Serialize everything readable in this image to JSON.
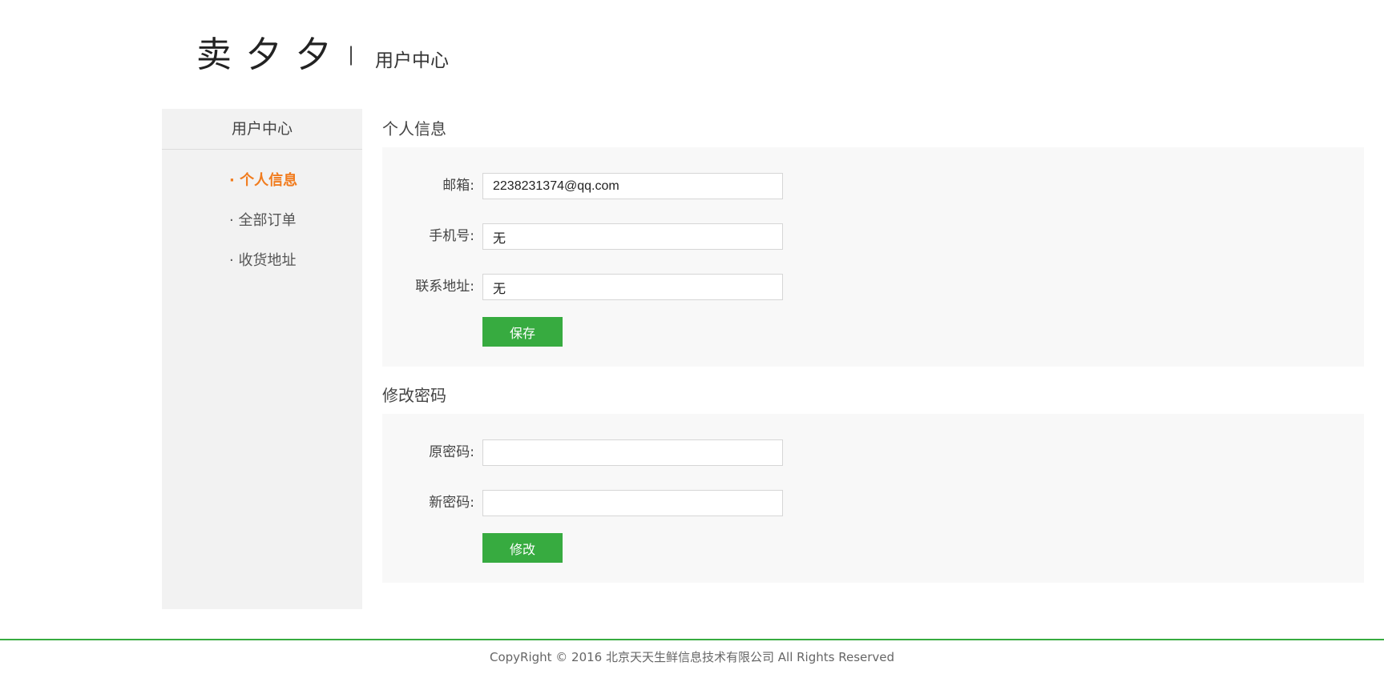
{
  "header": {
    "logo": "卖夕夕",
    "separator": "|",
    "title": "用户中心"
  },
  "sidebar": {
    "title": "用户中心",
    "items": [
      {
        "label": "· 个人信息",
        "active": true
      },
      {
        "label": "· 全部订单",
        "active": false
      },
      {
        "label": "· 收货地址",
        "active": false
      }
    ]
  },
  "profile": {
    "title": "个人信息",
    "email_label": "邮箱:",
    "email_value": "2238231374@qq.com",
    "phone_label": "手机号:",
    "phone_value": "无",
    "address_label": "联系地址:",
    "address_value": "无",
    "save_label": "保存"
  },
  "password": {
    "title": "修改密码",
    "old_label": "原密码:",
    "old_value": "",
    "new_label": "新密码:",
    "new_value": "",
    "submit_label": "修改"
  },
  "footer": {
    "text": "CopyRight © 2016 北京天天生鲜信息技术有限公司 All Rights Reserved"
  },
  "colors": {
    "accent_green": "#37ab40",
    "active_orange": "#f17c1e",
    "panel_bg": "#f8f8f8",
    "sidebar_bg": "#f2f2f2"
  }
}
